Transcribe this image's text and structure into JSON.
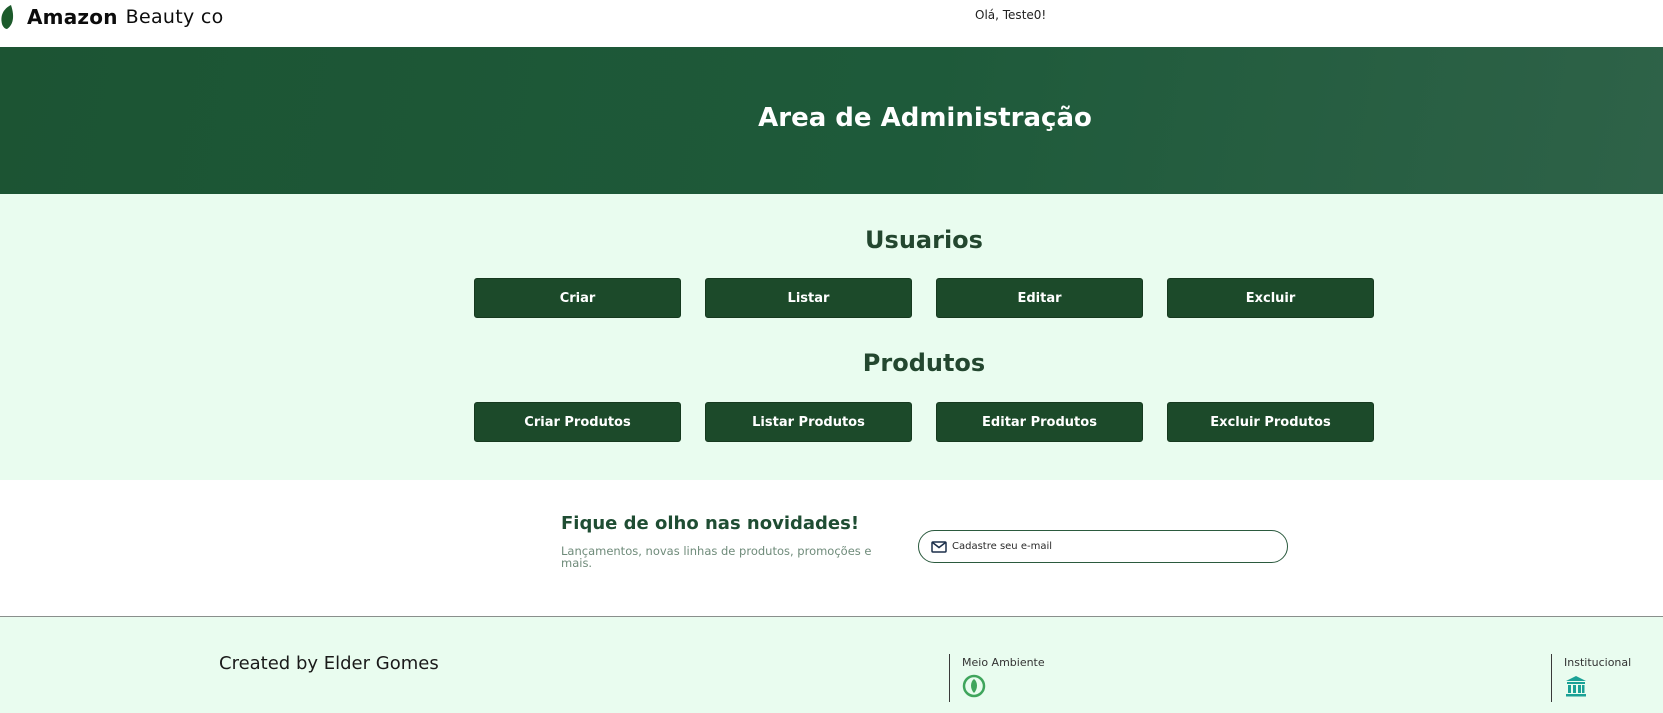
{
  "header": {
    "brand_strong": "Amazon",
    "brand_light": "Beauty co",
    "greeting": "Olá, Teste0!"
  },
  "banner": {
    "title": "Area de Administração"
  },
  "admin": {
    "users": {
      "title": "Usuarios",
      "buttons": [
        "Criar",
        "Listar",
        "Editar",
        "Excluir"
      ]
    },
    "products": {
      "title": "Produtos",
      "buttons": [
        "Criar Produtos",
        "Listar Produtos",
        "Editar Produtos",
        "Excluir Produtos"
      ]
    }
  },
  "newsletter": {
    "title": "Fique de olho nas novidades!",
    "subtitle": "Lançamentos, novas linhas de produtos, promoções e mais.",
    "email_placeholder": "Cadastre seu e-mail",
    "email_value": ""
  },
  "footer": {
    "credit": "Created by Elder Gomes",
    "columns": [
      {
        "label": "Meio Ambiente",
        "icon": "leaf-circle-icon"
      },
      {
        "label": "Institucional",
        "icon": "bank-icon"
      }
    ]
  },
  "colors": {
    "brand_green": "#1c5433",
    "button_green": "#1c4a2a",
    "section_bg": "#e9fcef",
    "leaf_green": "#2f9a53",
    "institution_teal": "#1aa196"
  }
}
